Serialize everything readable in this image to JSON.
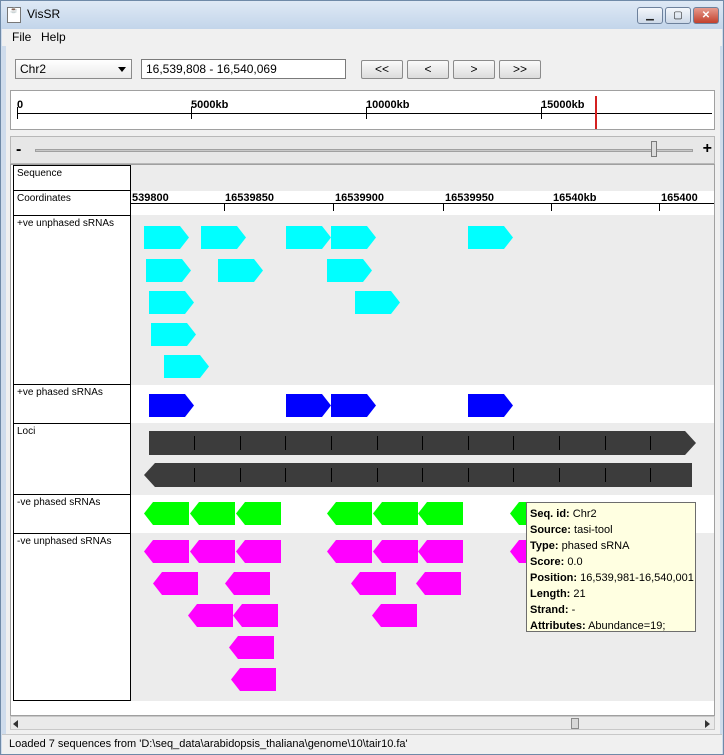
{
  "window": {
    "title": "VisSR",
    "icon": "jar-app-icon"
  },
  "title_buttons": {
    "minimize": "▁",
    "maximize": "▢",
    "close": "✕"
  },
  "menu": {
    "file": "File",
    "help": "Help"
  },
  "toolbar": {
    "chromosome": "Chr2",
    "range": "16,539,808 - 16,540,069",
    "btn_first": "<<",
    "btn_prev": "<",
    "btn_next": ">",
    "btn_last": ">>"
  },
  "overview": {
    "ticks": [
      "0",
      "5000kb",
      "10000kb",
      "15000kb"
    ],
    "marker_color": "#d42020"
  },
  "zoom": {
    "minus": "-",
    "plus": "+",
    "level": 0.94
  },
  "tracks": {
    "sequence": "Sequence",
    "coordinates": "Coordinates",
    "pos_unphased": "+ve unphased sRNAs",
    "pos_phased": "+ve phased sRNAs",
    "loci": "Loci",
    "neg_phased": "-ve phased sRNAs",
    "neg_unphased": "-ve unphased sRNAs"
  },
  "coordinates": [
    "539800",
    "16539850",
    "16539900",
    "16539950",
    "16540kb",
    "165400"
  ],
  "colors": {
    "pos_unphased": "#00ffff",
    "pos_phased": "#0000ff",
    "loci": "#3c3c3c",
    "neg_phased": "#00ff00",
    "neg_unphased": "#ff00ff"
  },
  "tooltip": {
    "seq_id_label": "Seq. id:",
    "seq_id": "Chr2",
    "source_label": "Source:",
    "source": "tasi-tool",
    "type_label": "Type:",
    "type": "phased sRNA",
    "score_label": "Score:",
    "score": "0.0",
    "position_label": "Position:",
    "position": "16,539,981-16,540,001",
    "length_label": "Length:",
    "length": "21",
    "strand_label": "Strand:",
    "strand": "-",
    "attributes_label": "Attributes:",
    "attributes": "Abundance=19;"
  },
  "status": "Loaded 7 sequences from 'D:\\seq_data\\arabidopsis_thaliana\\genome\\10\\tair10.fa'"
}
